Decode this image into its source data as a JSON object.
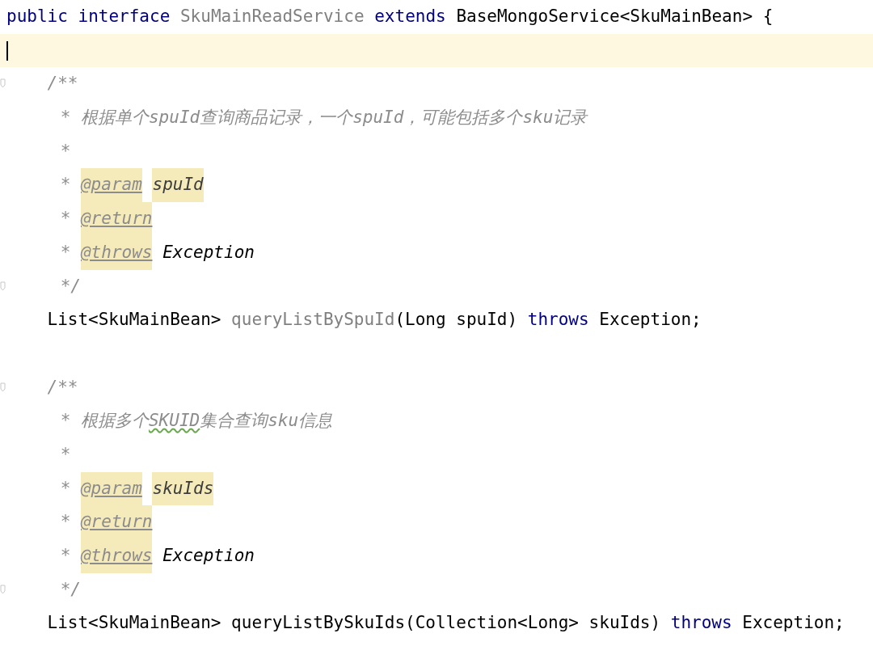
{
  "editor": {
    "header": [
      {
        "text": "public",
        "kind": "keyword"
      },
      {
        "text": "interface",
        "kind": "keyword"
      },
      {
        "text": "SkuMainReadService",
        "kind": "unused"
      },
      {
        "text": "extends",
        "kind": "keyword"
      },
      {
        "text": "BaseMongoService<SkuMainBean>",
        "kind": "plain"
      },
      {
        "text": "{",
        "kind": "plain"
      }
    ],
    "cursor_line": {
      "current": true
    },
    "members": [
      {
        "doc_open": "/**",
        "doc_close": "*/",
        "doc_lines": [
          [
            {
              "text": "*",
              "kind": "comment"
            },
            {
              "text": "根据单个spuId查询商品记录，一个spuId，可能包括多个sku记录",
              "kind": "comment"
            }
          ],
          [
            {
              "text": "*",
              "kind": "comment"
            }
          ],
          [
            {
              "text": "*",
              "kind": "comment"
            },
            {
              "text": "@param",
              "kind": "tag"
            },
            {
              "text": "spuId",
              "kind": "param"
            }
          ],
          [
            {
              "text": "*",
              "kind": "comment"
            },
            {
              "text": "@return",
              "kind": "tag"
            }
          ],
          [
            {
              "text": "*",
              "kind": "comment"
            },
            {
              "text": "@throws",
              "kind": "tag"
            },
            {
              "text": "Exception",
              "kind": "doc_code"
            }
          ]
        ],
        "signature": [
          {
            "text": "List<SkuMainBean>",
            "kind": "plain"
          },
          {
            "text": "queryListBySpuId",
            "kind": "unused"
          },
          {
            "text": "(Long spuId)",
            "kind": "plain",
            "attach": true
          },
          {
            "text": "throws",
            "kind": "keyword"
          },
          {
            "text": "Exception;",
            "kind": "plain"
          }
        ]
      },
      {
        "doc_open": "/**",
        "doc_close": "*/",
        "doc_lines": [
          [
            {
              "text": "*",
              "kind": "comment"
            },
            {
              "text": "根据多个",
              "kind": "comment"
            },
            {
              "text": "SKUID",
              "kind": "typo",
              "attach": true
            },
            {
              "text": "集合查询sku信息",
              "kind": "comment",
              "attach": true
            }
          ],
          [
            {
              "text": "*",
              "kind": "comment"
            }
          ],
          [
            {
              "text": "*",
              "kind": "comment"
            },
            {
              "text": "@param",
              "kind": "tag"
            },
            {
              "text": "skuIds",
              "kind": "param"
            }
          ],
          [
            {
              "text": "*",
              "kind": "comment"
            },
            {
              "text": "@return",
              "kind": "tag"
            }
          ],
          [
            {
              "text": "*",
              "kind": "comment"
            },
            {
              "text": "@throws",
              "kind": "tag"
            },
            {
              "text": "Exception",
              "kind": "doc_code"
            }
          ]
        ],
        "signature": [
          {
            "text": "List<SkuMainBean>",
            "kind": "plain"
          },
          {
            "text": "queryListBySkuIds(Collection<Long> skuIds)",
            "kind": "plain"
          },
          {
            "text": "throws",
            "kind": "keyword"
          },
          {
            "text": "Exception;",
            "kind": "plain"
          }
        ]
      }
    ]
  }
}
